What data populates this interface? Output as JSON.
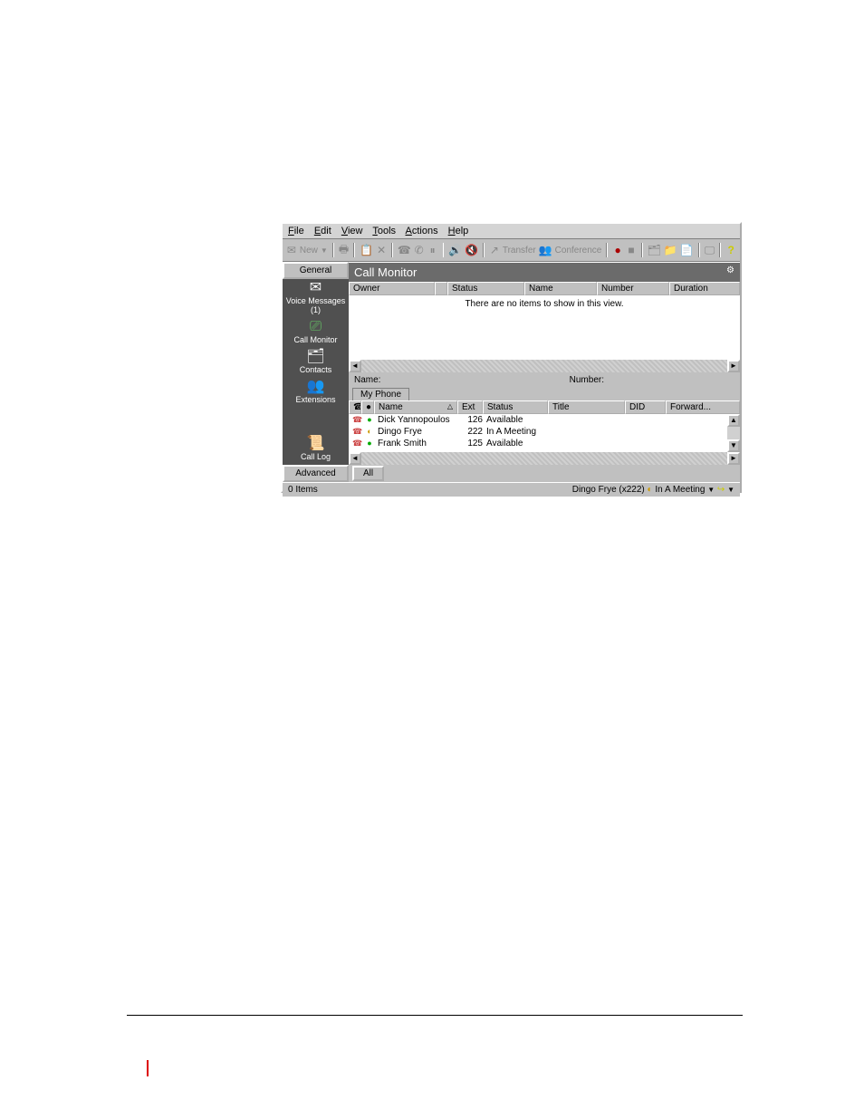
{
  "menu": {
    "file": "File",
    "edit": "Edit",
    "view": "View",
    "tools": "Tools",
    "actions": "Actions",
    "help": "Help"
  },
  "toolbar": {
    "new": "New",
    "transfer": "Transfer",
    "conference": "Conference"
  },
  "sidebar": {
    "general": "General",
    "voice_messages": "Voice Messages (1)",
    "call_monitor": "Call Monitor",
    "contacts": "Contacts",
    "extensions": "Extensions",
    "call_log": "Call Log",
    "advanced": "Advanced"
  },
  "section": {
    "title": "Call Monitor"
  },
  "columns": {
    "owner": "Owner",
    "status": "Status",
    "name": "Name",
    "number": "Number",
    "duration": "Duration"
  },
  "empty_message": "There are no items to show in this view.",
  "midbar": {
    "name_label": "Name:",
    "number_label": "Number:"
  },
  "tabs": {
    "my_phone": "My Phone",
    "all": "All"
  },
  "ext_columns": {
    "name": "Name",
    "ext": "Ext",
    "status": "Status",
    "title": "Title",
    "did": "DID",
    "forward": "Forward..."
  },
  "extensions": [
    {
      "name": "Dick Yannopoulos",
      "ext": "126",
      "status": "Available"
    },
    {
      "name": "Dingo Frye",
      "ext": "222",
      "status": "In A Meeting"
    },
    {
      "name": "Frank Smith",
      "ext": "125",
      "status": "Available"
    }
  ],
  "statusbar": {
    "items": "0 Items",
    "user": "Dingo Frye (x222)",
    "status": "In A Meeting"
  }
}
